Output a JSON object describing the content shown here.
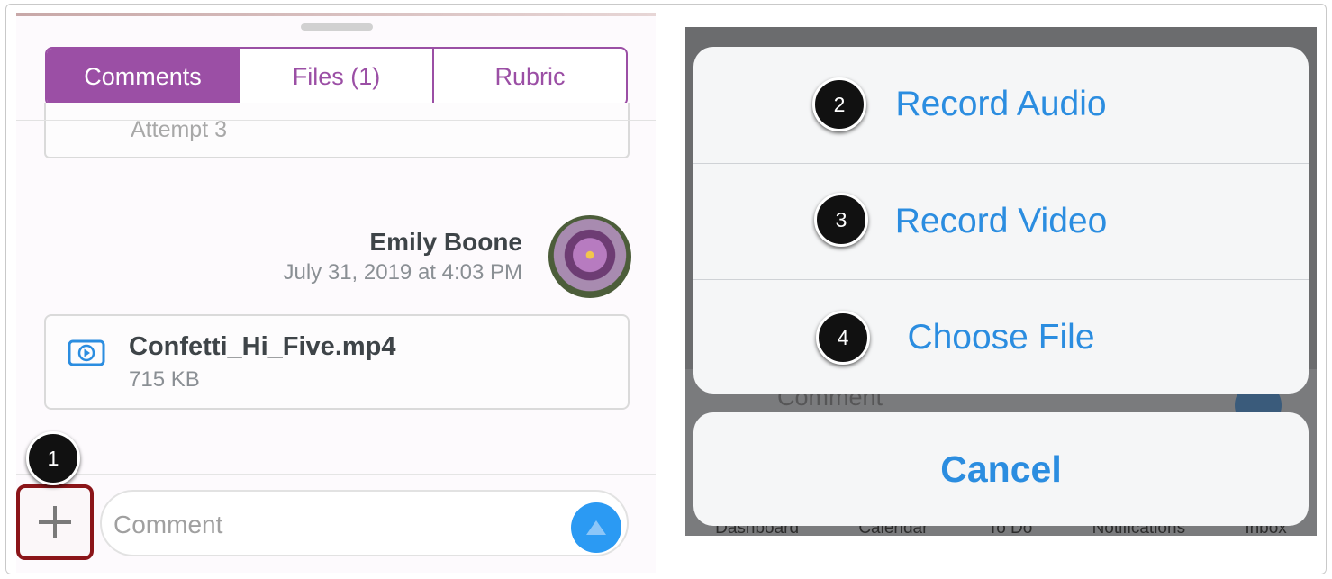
{
  "left_panel": {
    "tabs": [
      {
        "label": "Comments",
        "active": true
      },
      {
        "label": "Files (1)",
        "active": false
      },
      {
        "label": "Rubric",
        "active": false
      }
    ],
    "attempt_label": "Attempt 3",
    "comment": {
      "author": "Emily Boone",
      "timestamp": "July 31, 2019 at 4:03 PM",
      "avatar_icon": "flower-avatar"
    },
    "attachment": {
      "icon": "video-file-icon",
      "name": "Confetti_Hi_Five.mp4",
      "size": "715 KB"
    },
    "composer": {
      "add_icon": "plus-icon",
      "placeholder": "Comment",
      "send_icon": "send-up-arrow-icon"
    }
  },
  "right_panel": {
    "action_sheet": {
      "options": [
        {
          "label": "Record Audio",
          "step": "2"
        },
        {
          "label": "Record Video",
          "step": "3"
        },
        {
          "label": "Choose File",
          "step": "4"
        }
      ],
      "cancel_label": "Cancel"
    },
    "background": {
      "comment_placeholder": "Comment",
      "tab_bar": [
        "Dashboard",
        "Calendar",
        "To Do",
        "Notifications",
        "Inbox"
      ]
    }
  },
  "steps": {
    "step1": "1"
  },
  "colors": {
    "accent_purple": "#9b4fa5",
    "action_blue": "#2b8de0",
    "highlight_red": "#8b1519"
  }
}
